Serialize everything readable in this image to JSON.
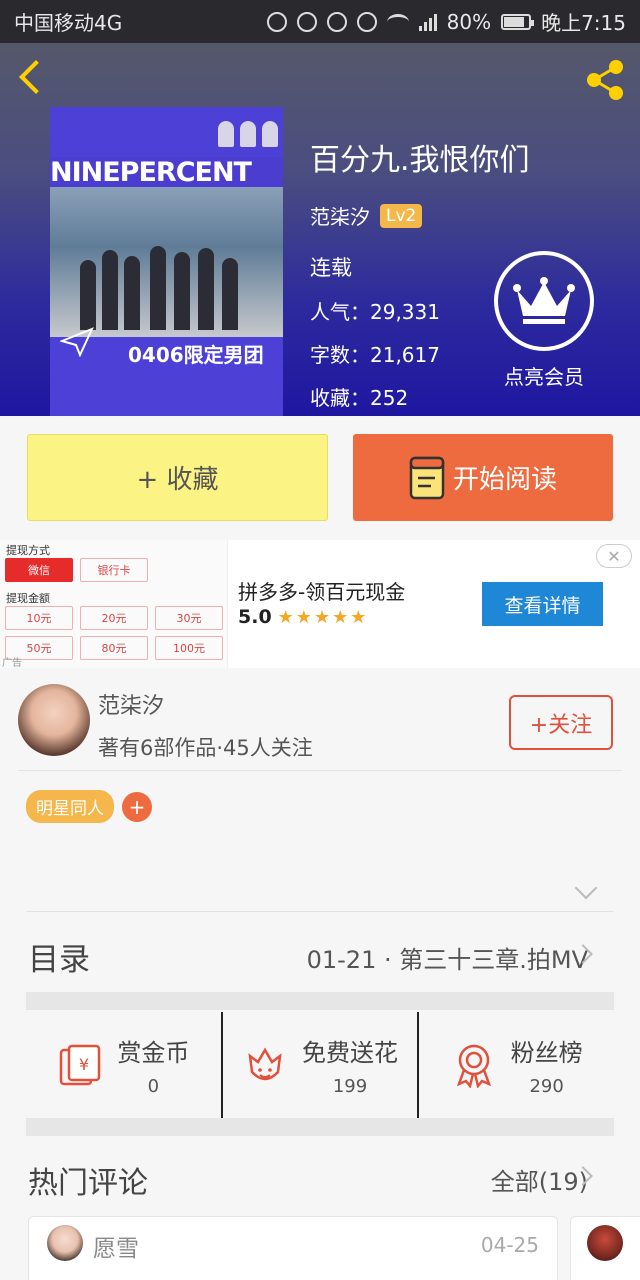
{
  "status_bar": {
    "carrier": "中国移动4G",
    "battery": "80%",
    "time": "晚上7:15",
    "network_badge": "46"
  },
  "book": {
    "title": "百分九.我恨你们",
    "author": "范柒汐",
    "level": "Lv2",
    "status": "连载",
    "popularity_label": "人气：",
    "popularity": "29,331",
    "words_label": "字数：",
    "words": "21,617",
    "favorites_label": "收藏：",
    "favorites": "252",
    "cover": {
      "top_text": "NINEPERCENT",
      "bottom_text": "0406限定男团"
    }
  },
  "vip": {
    "label": "点亮会员"
  },
  "actions": {
    "favorite_label": "+ 收藏",
    "read_label": "开始阅读"
  },
  "ad": {
    "title": "拼多多-领百元现金",
    "rating": "5.0",
    "stars": "★★★★★",
    "cta": "查看详情",
    "close": "✕",
    "image": {
      "withdraw_method": "提现方式",
      "wechat": "微信",
      "bank_card": "银行卡",
      "withdraw_amount": "提现金额",
      "amounts": [
        "10元",
        "20元",
        "30元",
        "50元",
        "80元",
        "100元"
      ],
      "badge": "广告"
    }
  },
  "author": {
    "name": "范柒汐",
    "meta": "著有6部作品·45人关注",
    "follow_label": "+关注"
  },
  "tags": [
    "明星同人"
  ],
  "tag_add": "+",
  "catalog": {
    "label": "目录",
    "latest": "01-21 · 第三十三章.拍MV"
  },
  "stats": [
    {
      "label": "赏金币",
      "value": "0",
      "icon": "reward-envelope-icon"
    },
    {
      "label": "免费送花",
      "value": "199",
      "icon": "flower-icon"
    },
    {
      "label": "粉丝榜",
      "value": "290",
      "icon": "ribbon-medal-icon"
    }
  ],
  "comments": {
    "label": "热门评论",
    "all": "全部(19)",
    "items": [
      {
        "name": "愿雪",
        "date": "04-25"
      }
    ]
  },
  "colors": {
    "accent_orange": "#ee6b3f",
    "favorite_yellow": "#fbf383",
    "header_blue": "#2d2a9e",
    "tag_yellow": "#f5b64b",
    "ad_blue": "#1e87d6"
  }
}
